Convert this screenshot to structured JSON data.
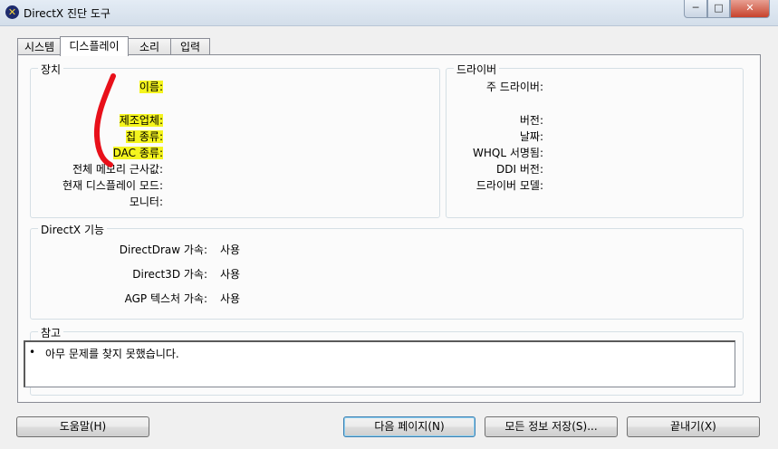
{
  "window": {
    "title": "DirectX 진단 도구",
    "icon": "directx-icon",
    "controls": {
      "minimize": "─",
      "maximize": "□",
      "close": "✕"
    }
  },
  "tabs": [
    {
      "label": "시스템"
    },
    {
      "label": "디스플레이"
    },
    {
      "label": "소리"
    },
    {
      "label": "입력"
    }
  ],
  "device": {
    "title": "장치",
    "labels": {
      "name": "이름:",
      "manufacturer": "제조업체:",
      "chip_type": "칩 종류:",
      "dac_type": "DAC 종류:",
      "total_memory": "전체 메모리 근사값:",
      "display_mode": "현재 디스플레이 모드:",
      "monitor": "모니터:"
    }
  },
  "driver": {
    "title": "드라이버",
    "labels": {
      "main_driver": "주 드라이버:",
      "version": "버전:",
      "date": "날짜:",
      "whql": "WHQL 서명됨:",
      "ddi_version": "DDI 버전:",
      "driver_model": "드라이버 모델:"
    }
  },
  "features": {
    "title": "DirectX 기능",
    "items": [
      {
        "label": "DirectDraw 가속:",
        "value": "사용"
      },
      {
        "label": "Direct3D 가속:",
        "value": "사용"
      },
      {
        "label": "AGP 텍스처 가속:",
        "value": "사용"
      }
    ]
  },
  "notes": {
    "title": "참고",
    "bullet": "•",
    "items": [
      "아무 문제를 찾지 못했습니다."
    ]
  },
  "buttons": {
    "help": "도움말(H)",
    "next_page": "다음 페이지(N)",
    "save_all": "모든 정보 저장(S)...",
    "exit": "끝내기(X)"
  },
  "colors": {
    "highlight": "#f4f41e",
    "annotation": "#e8101a"
  }
}
